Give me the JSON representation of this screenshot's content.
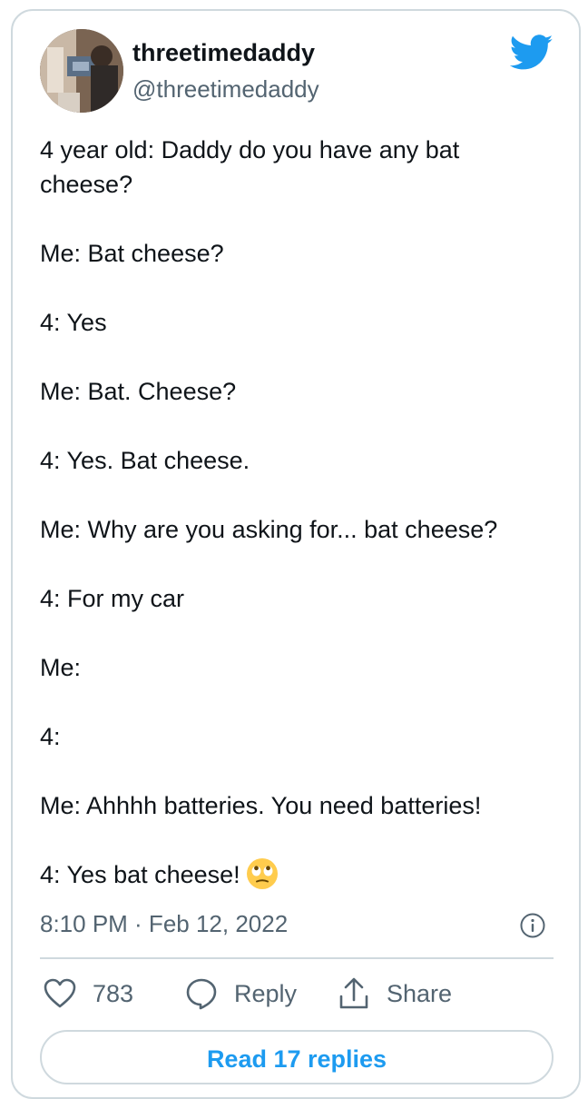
{
  "author": {
    "display_name": "threetimedaddy",
    "handle": "@threetimedaddy"
  },
  "tweet": {
    "lines": [
      "4 year old: Daddy do you have any bat",
      "cheese?",
      "Me: Bat cheese?",
      "4: Yes",
      "Me: Bat. Cheese?",
      "4: Yes. Bat cheese.",
      "Me: Why are you asking for... bat cheese?",
      "4: For my car",
      "Me:",
      "4:",
      "Me: Ahhhh batteries. You need batteries!",
      "4: Yes bat cheese!"
    ],
    "emoji_name": "face-with-rolling-eyes",
    "timestamp": "8:10 PM · Feb 12, 2022"
  },
  "actions": {
    "like_count": "783",
    "reply_label": "Reply",
    "share_label": "Share"
  },
  "read_replies_label": "Read 17 replies",
  "colors": {
    "brand_blue": "#1d9bf0",
    "secondary_text": "#536471",
    "border": "#cfd9de"
  }
}
